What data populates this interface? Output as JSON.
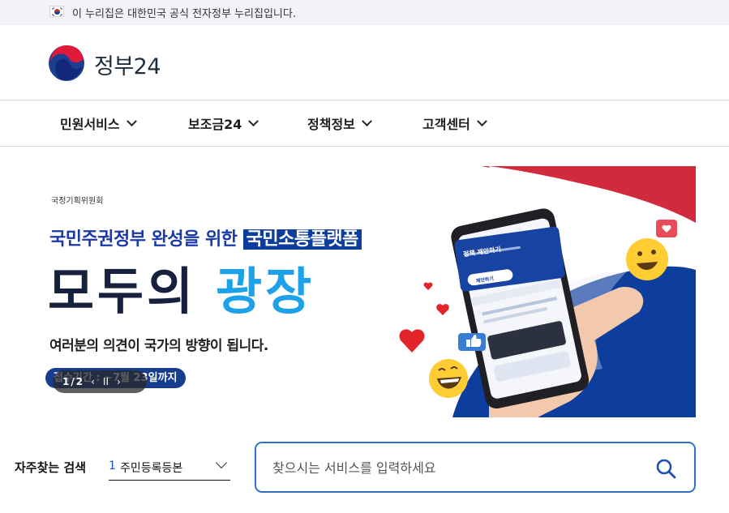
{
  "topbar": {
    "notice": "이 누리집은 대한민국 공식 전자정부 누리집입니다.",
    "flag_icon": "taegukgi-flag-icon"
  },
  "header": {
    "logo_text": "정부24",
    "logo_icon": "government-emblem-icon"
  },
  "nav": {
    "items": [
      {
        "label": "민원서비스"
      },
      {
        "label": "보조금24"
      },
      {
        "label": "정책정보"
      },
      {
        "label": "고객센터"
      }
    ]
  },
  "banner": {
    "ministry": "국정기획위원회",
    "headline_pre": "국민주권정부 완성을 위한",
    "headline_highlight": "국민소통플랫폼",
    "title_part1": "모두의",
    "title_part2": "광장",
    "description": "여러분의 의견이 국가의 방향이 됩니다.",
    "period": "접수기간 : ~7월 23일까지",
    "pager": {
      "current": "1",
      "separator": "/",
      "total": "2",
      "prev": "‹",
      "pause": "II",
      "next": "›"
    },
    "phone_card": {
      "title": "정책 제안하기",
      "button": "제안하기"
    },
    "colors": {
      "navy": "#16213e",
      "sky": "#1da1e8",
      "red": "#d12a3d",
      "blue": "#0d3e9e"
    }
  },
  "search": {
    "frequent_label": "자주찾는 검색",
    "frequent_number": "1",
    "frequent_item": "주민등록등본",
    "placeholder": "찾으시는 서비스를 입력하세요",
    "search_icon": "search-icon"
  }
}
